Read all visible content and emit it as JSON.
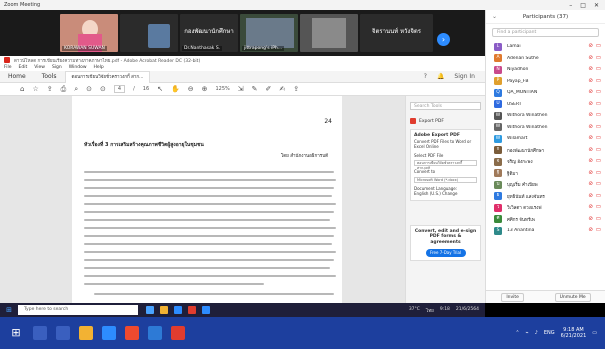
{
  "zoom": {
    "title": "Zoom Meeting"
  },
  "video": {
    "tiles": [
      {
        "name": "KORAWAN SUWAN",
        "color": "#c98c7a"
      },
      {
        "name": "",
        "color": "#2b2b2b"
      },
      {
        "name": "Dr.Nanthasak S.",
        "color": "#3a5a3a"
      },
      {
        "name": "jittrapong's iPh...",
        "color": "#2a2a2a"
      },
      {
        "name": "",
        "color": "#444"
      },
      {
        "name": "Lamai Suraphan",
        "color": "#7a8ba0"
      }
    ],
    "big_names": [
      "กองพัฒนานักศึกษา",
      "จิตรานนท์ หวังจิตร"
    ],
    "next_icon": "chevron-right-icon"
  },
  "acrobat": {
    "window_title": "ดาวน์โหลด การเขียนเรียงความทางภาคภาษาไทย.pdf - Adobe Acrobat Reader DC (32-bit)",
    "menu": [
      "File",
      "Edit",
      "View",
      "Sign",
      "Window",
      "Help"
    ],
    "tabs": {
      "home": "Home",
      "tools": "Tools",
      "doc": "ตอนการเขียนวิจัยชั่วคราวงกกี้ สาก..."
    },
    "right_tabs": {
      "help": "?",
      "bell": "🔔",
      "signin": "Sign In"
    },
    "toolbar": {
      "page_current": "4",
      "page_total": "16",
      "zoom": "125%"
    },
    "page": {
      "number": "24",
      "chapter": "หัวเรื่องที่ 3 การเสริมสร้างคุณภาพชีวิตผู้สูงอายุในชุมชน",
      "author": "โดย สำนักงานอธิการบดี"
    },
    "pane": {
      "search_placeholder": "Search Tools",
      "export_label": "Export PDF",
      "card_title": "Adobe Export PDF",
      "card_text": "Convert PDF Files to Word or Excel Online",
      "select_label": "Select PDF File",
      "select_value": "ตอนการเขียนวิจัยชั่วคราวงกกี้ สาก.pdf",
      "convert_label": "Convert to",
      "convert_value": "Microsoft Word (*.docx)",
      "lang_label": "Document Language:",
      "lang_value": "English (U.S.) Change",
      "promo": "Convert, edit and e-sign PDF forms & agreements",
      "promo_btn": "Free 7-Day Trial"
    }
  },
  "participants": {
    "header": "Participants (37)",
    "find_placeholder": "Find a participant",
    "list": [
      {
        "initial": "L",
        "name": "Lamai",
        "color": "#8b5cc6"
      },
      {
        "initial": "A",
        "name": "Adenan Suthe",
        "color": "#e07a2e"
      },
      {
        "initial": "N",
        "name": "Niyadhon",
        "color": "#c94a8c"
      },
      {
        "initial": "P",
        "name": "Payap_FB",
        "color": "#e0a02e"
      },
      {
        "initial": "Q",
        "name": "QA_MONTIAN",
        "color": "#2e7ae0"
      },
      {
        "initial": "U",
        "name": "USERT",
        "color": "#2e6ae0"
      },
      {
        "initial": "W",
        "name": "Withora Winathen",
        "color": "#555"
      },
      {
        "initial": "W",
        "name": "Withora Winathen",
        "color": "#666"
      },
      {
        "initial": "W",
        "name": "Wilamart",
        "color": "#2e9ae0"
      },
      {
        "initial": "ก",
        "name": "กองพัฒนานักศึกษา",
        "color": "#7a5c3a"
      },
      {
        "initial": "จ",
        "name": "จริญ อังกะพง",
        "color": "#8a6c4a"
      },
      {
        "initial": "ฐ",
        "name": "ฐิติมา",
        "color": "#a07a5a"
      },
      {
        "initial": "บ",
        "name": "บุญเริ่ม คำเปียพ",
        "color": "#6a8a5a"
      },
      {
        "initial": "ย",
        "name": "ยุทธินันท์ แสงจันทร",
        "color": "#2e7ae0"
      },
      {
        "initial": "ว",
        "name": "วิเวิลตา ดวงแรงฟ",
        "color": "#e02e6a"
      },
      {
        "initial": "ศ",
        "name": "ศศิกร จันทร์เพ",
        "color": "#3a8a3a"
      },
      {
        "initial": "S",
        "name": "13 Anantina",
        "color": "#2e8a8a"
      }
    ],
    "footer": {
      "invite": "Invite",
      "unmute": "Unmute Me"
    }
  },
  "inner_taskbar": {
    "search": "Type here to search",
    "tray_weather": "37°C",
    "tray_lang": "ไทย",
    "time": "9:18",
    "date": "21/6/2564"
  },
  "outer_taskbar": {
    "lang": "ENG",
    "time": "9:18 AM",
    "date": "6/21/2021"
  }
}
